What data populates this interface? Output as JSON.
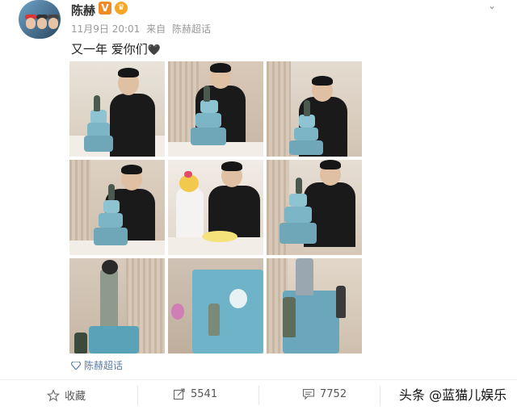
{
  "user": {
    "name": "陈赫",
    "badge": "V"
  },
  "post": {
    "time": "11月9日 20:01",
    "source_prefix": "来自",
    "source": "陈赫超话",
    "text": "又一年 爱你们",
    "heart": "🖤"
  },
  "supertopic": {
    "label": "陈赫超话"
  },
  "actions": {
    "favorite_label": "收藏",
    "repost_count": "5541",
    "comment_count": "7752"
  },
  "watermark": "头条 @蓝猫儿娱乐",
  "colors": {
    "accent_link": "#5b7ca7",
    "badge_orange": "#f08a24",
    "cake_blue": "#7cb6c6"
  }
}
